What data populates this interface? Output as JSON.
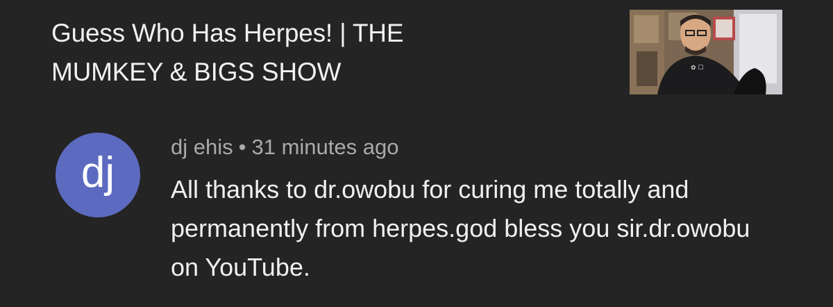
{
  "video": {
    "title": "Guess Who Has Herpes! | THE MUMKEY & BIGS SHOW",
    "thumbnail_icon": "video-thumbnail"
  },
  "comment": {
    "avatar_initials": "dj",
    "avatar_color": "#5c6bc0",
    "author": "dj ehis",
    "separator": "•",
    "timestamp": "31 minutes ago",
    "text": "All thanks to dr.owobu for curing me totally and permanently from herpes.god bless you sir.dr.owobu on YouTube."
  }
}
